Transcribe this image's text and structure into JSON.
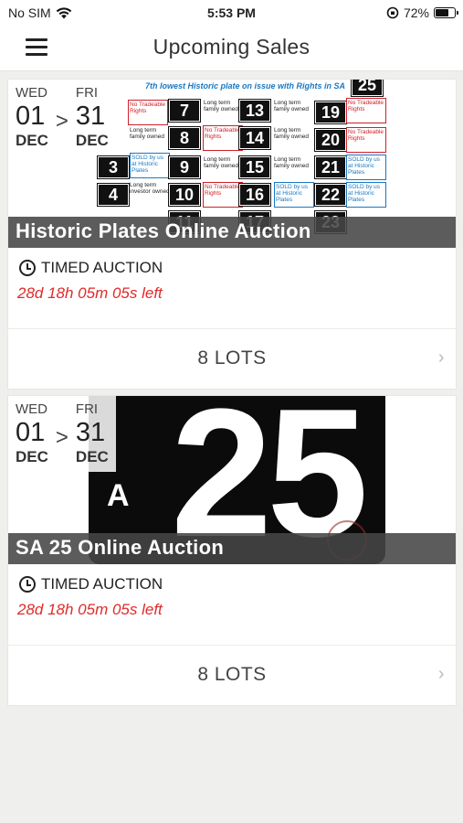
{
  "status_bar": {
    "carrier": "No SIM",
    "time": "5:53 PM",
    "battery": "72%",
    "battery_level": 0.72,
    "icons": [
      "wifi-icon",
      "orientation-lock-icon",
      "battery-icon"
    ]
  },
  "nav": {
    "title": "Upcoming Sales",
    "menu_icon": "hamburger-menu-icon"
  },
  "sales": [
    {
      "title": "Historic Plates Online Auction",
      "start": {
        "dow": "WED",
        "day": "01",
        "month": "DEC"
      },
      "separator": ">",
      "end": {
        "dow": "FRI",
        "day": "31",
        "month": "DEC"
      },
      "auction_type": "TIMED AUCTION",
      "time_left": "28d 18h 05m 05s left",
      "lots": "8 LOTS",
      "image": {
        "caption": "7th lowest Historic plate on issue with Rights in SA",
        "plates": [
          "25",
          "7",
          "13",
          "19",
          "8",
          "14",
          "20",
          "3",
          "9",
          "15",
          "21",
          "4",
          "10",
          "16",
          "22",
          "11",
          "17",
          "23"
        ],
        "notes": [
          "Long term family owned",
          "No Tradeable Rights",
          "SOLD by us at Historic Plates",
          "Long term investor owned"
        ]
      }
    },
    {
      "title": "SA 25 Online Auction",
      "start": {
        "dow": "WED",
        "day": "01",
        "month": "DEC"
      },
      "separator": ">",
      "end": {
        "dow": "FRI",
        "day": "31",
        "month": "DEC"
      },
      "auction_type": "TIMED AUCTION",
      "time_left": "28d 18h 05m 05s left",
      "lots": "8 LOTS",
      "image": {
        "plate_number": "25",
        "plate_state": "A"
      }
    }
  ],
  "colors": {
    "background": "#efefed",
    "time_left": "#e02a2a",
    "title_overlay": "#464646"
  }
}
